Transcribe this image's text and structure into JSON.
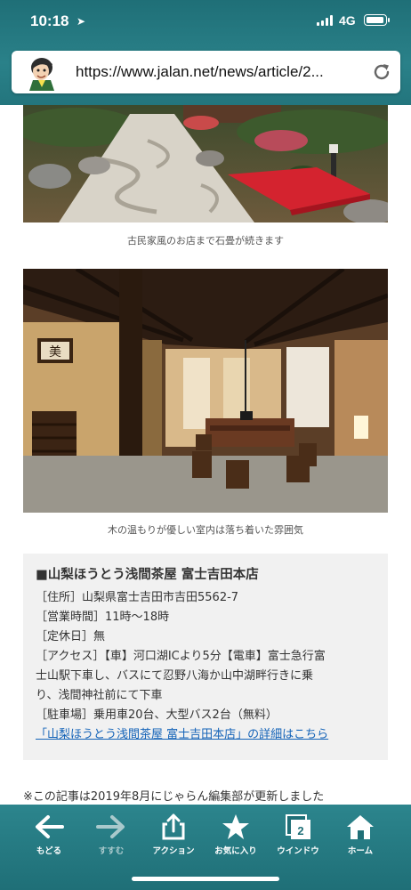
{
  "status_bar": {
    "time": "10:18",
    "location_icon": "location-arrow-icon",
    "network": "4G",
    "battery_icon": "battery-icon"
  },
  "browser": {
    "url": "https://www.jalan.net/news/article/2...",
    "reload_icon": "reload-icon",
    "avatar_icon": "character-avatar-icon"
  },
  "article": {
    "photo1_caption": "古民家風のお店まで石畳が続きます",
    "photo2_caption": "木の温もりが優しい室内は落ち着いた雰囲気",
    "shop": {
      "name": "■山梨ほうとう浅間茶屋 富士吉田本店",
      "address": "［住所］山梨県富士吉田市吉田5562-7",
      "hours": "［営業時間］11時～18時",
      "holiday": "［定休日］無",
      "access_1": "［アクセス］【車】河口湖ICより5分【電車】富士急行富",
      "access_2": "士山駅下車し、バスにて忍野八海か山中湖畔行きに乗",
      "access_3": "り、浅間神社前にて下車",
      "parking": "［駐車場］乗用車20台、大型バス2台（無料）",
      "detail_link": "「山梨ほうとう浅間茶屋 富士吉田本店」の詳細はこちら"
    },
    "note": "※この記事は2019年8月にじゃらん編集部が更新しました"
  },
  "toolbar": {
    "back": "もどる",
    "forward": "すすむ",
    "action": "アクション",
    "favorites": "お気に入り",
    "windows": "ウインドウ",
    "window_count": "2",
    "home": "ホーム"
  },
  "colors": {
    "toolbar_teal": "#23757d",
    "link_blue": "#1463b8",
    "info_bg": "#f1f1f1"
  }
}
